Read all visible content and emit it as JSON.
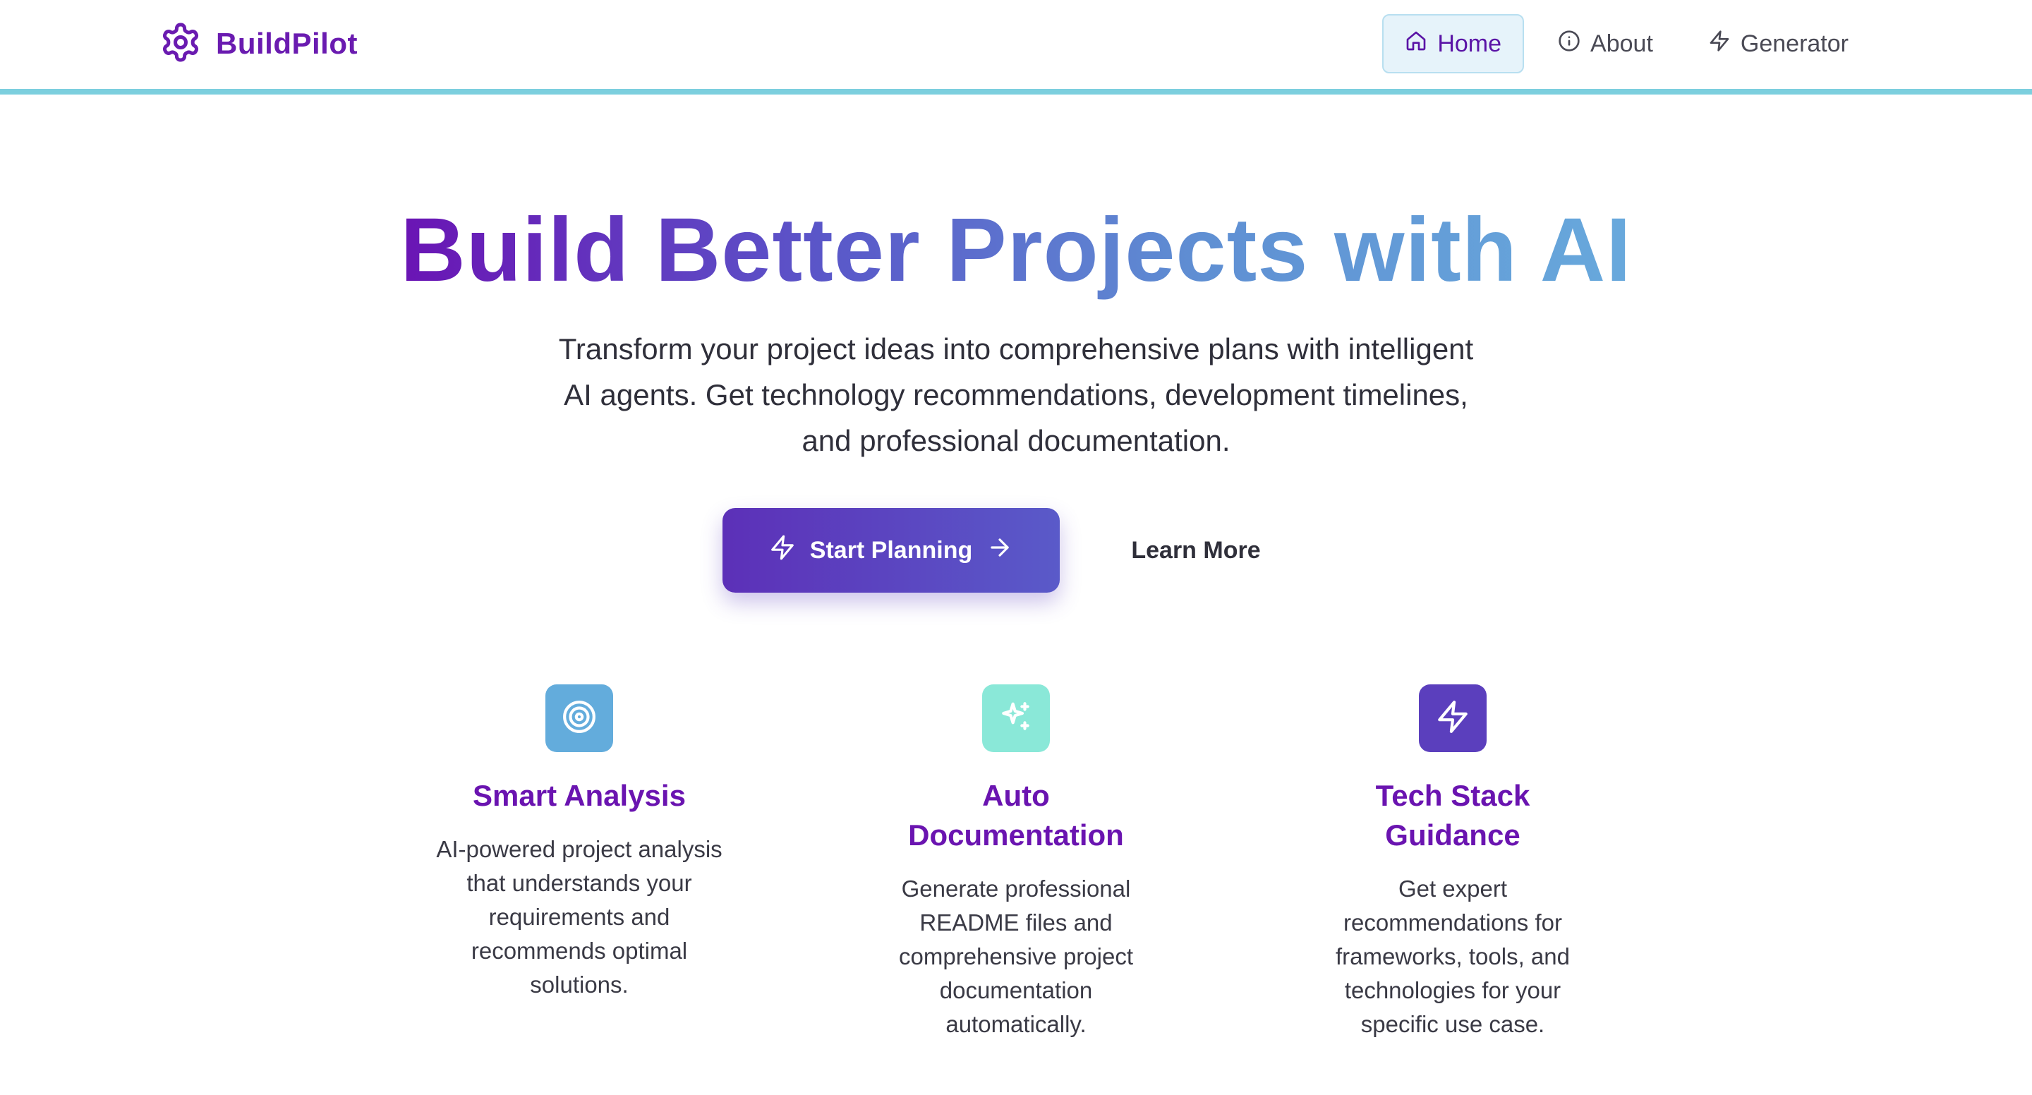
{
  "brand": {
    "name": "BuildPilot",
    "logo_icon": "gear-icon",
    "color": "#6a1bb0"
  },
  "nav": {
    "items": [
      {
        "label": "Home",
        "icon": "home-icon",
        "active": true
      },
      {
        "label": "About",
        "icon": "info-icon",
        "active": false
      },
      {
        "label": "Generator",
        "icon": "lightning-icon",
        "active": false
      }
    ]
  },
  "hero": {
    "title": "Build Better Projects with AI",
    "subtitle": "Transform your project ideas into comprehensive plans with intelligent AI agents. Get technology recommendations, development timelines, and professional documentation.",
    "primary_cta": {
      "label": "Start Planning",
      "icon_left": "lightning-icon",
      "icon_right": "arrow-right-icon"
    },
    "secondary_cta": {
      "label": "Learn More"
    }
  },
  "features": [
    {
      "title": "Smart Analysis",
      "description": "AI-powered project analysis that understands your requirements and recommends optimal solutions.",
      "icon": "target-icon",
      "icon_bg": "#63acdc"
    },
    {
      "title": "Auto Documentation",
      "description": "Generate professional README files and comprehensive project documentation automatically.",
      "icon": "sparkles-icon",
      "icon_bg": "#8ae8d8"
    },
    {
      "title": "Tech Stack Guidance",
      "description": "Get expert recommendations for frameworks, tools, and technologies for your specific use case.",
      "icon": "lightning-icon",
      "icon_bg": "#5b3fbd"
    }
  ],
  "colors": {
    "accent_purple": "#6a14b0",
    "accent_blue": "#68a9dc",
    "nav_border": "#7ccfde"
  }
}
